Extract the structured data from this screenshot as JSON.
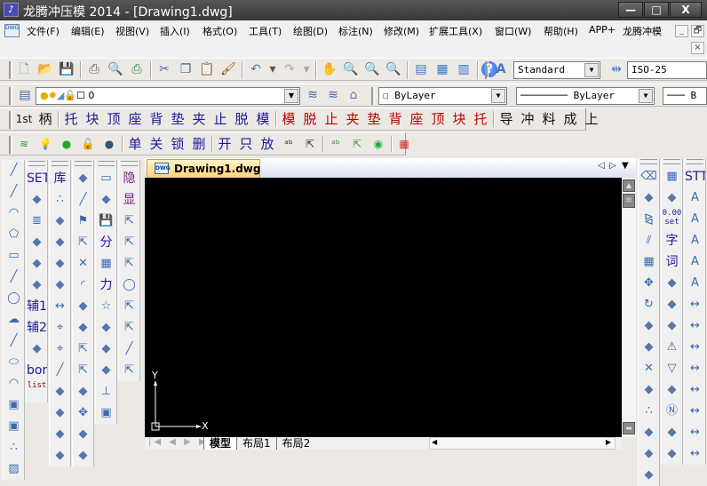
{
  "window": {
    "title": "龙腾冲压模 2014 - [Drawing1.dwg]",
    "minimize": "—",
    "maximize": "□",
    "close": "X"
  },
  "menu": [
    "文件(F)",
    "编辑(E)",
    "视图(V)",
    "插入(I)",
    "格式(O)",
    "工具(T)",
    "绘图(D)",
    "标注(N)",
    "修改(M)",
    "扩展工具(X)",
    "窗口(W)",
    "帮助(H)",
    "APP+",
    "龙腾冲模"
  ],
  "mdi": {
    "minimize": "_",
    "restore": "🗗",
    "close": "×"
  },
  "standard_toolbar": [
    "new-icon",
    "open-icon",
    "save-icon",
    "|",
    "print-icon",
    "print-preview-icon",
    "publish-icon",
    "|",
    "cut-icon",
    "copy-icon",
    "paste-icon",
    "match-properties-icon",
    "|",
    "undo-icon",
    "undo-dropdown-icon",
    "redo-icon",
    "redo-dropdown-icon",
    "|",
    "pan-icon",
    "zoom-realtime-icon",
    "zoom-window-icon",
    "zoom-previous-icon",
    "|",
    "properties-icon",
    "design-center-icon",
    "tool-palettes-icon",
    "|",
    "help-icon"
  ],
  "text_style": {
    "value": "Standard"
  },
  "dim_style": {
    "value": "ISO-25"
  },
  "layer": {
    "value": "0"
  },
  "color": {
    "value": "ByLayer"
  },
  "linetype": {
    "value": "ByLayer"
  },
  "lineweight": {
    "value": "B"
  },
  "row3": {
    "blue": [
      "1st",
      "柄",
      "托",
      "块",
      "顶",
      "座",
      "背",
      "垫",
      "夹",
      "止",
      "脱",
      "模"
    ],
    "red": [
      "模",
      "脱",
      "止",
      "夹",
      "垫",
      "背",
      "座",
      "顶",
      "块",
      "托"
    ],
    "black": [
      "导",
      "冲",
      "料",
      "成",
      "上"
    ]
  },
  "row4": {
    "texts": [
      "单",
      "关",
      "锁",
      "删",
      "开",
      "只",
      "放"
    ]
  },
  "left_cols": [
    [
      "line-icon",
      "polyline-icon",
      "arc-icon",
      "polygon-icon",
      "rectangle-icon",
      "spline-flyout-icon",
      "circle-icon",
      "revcloud-icon",
      "spline-icon",
      "ellipse-icon",
      "ellipse-arc-icon",
      "insert-block-icon",
      "make-block-icon",
      "point-icon",
      "hatch-icon"
    ],
    [
      {
        "t": "SET"
      },
      "frame-icon",
      "spring-icon",
      "plate-icon",
      "die-set-icon",
      "pin-icon",
      {
        "t": "辅1"
      },
      {
        "t": "辅2"
      },
      "material-icon",
      {
        "t": "bom"
      },
      {
        "t": "list"
      }
    ],
    [
      {
        "t": "库"
      },
      "square-point-icon",
      "slot-icon",
      "cavity-icon",
      "punch-icon",
      "plate-view-icon",
      "dimension-box-icon",
      "center-mark-icon",
      "target-icon",
      "hatch-lines-icon",
      "bend-icon",
      "zigzag-icon",
      "profile-icon",
      "pin-small-icon"
    ],
    [
      "broom-icon",
      "offset-lines-icon",
      "flag-icon",
      "flag-select-icon",
      "trim-icon",
      "fillet-icon",
      "edit-curve-icon",
      "break-icon",
      "gear-select-icon",
      "rotate-select-icon",
      "scale-icon",
      "move-diamond-icon",
      "stretch-icon",
      "sparkle-icon"
    ],
    [
      "window-icon",
      "cluster-icon",
      "disk-icon",
      {
        "t": "分"
      },
      "calculator-icon",
      {
        "t": "力"
      },
      "star-icon",
      "press-icon",
      "holes-icon",
      "stack-icon",
      "bolt-icon",
      "punch-block-icon"
    ],
    [
      {
        "t": "隐"
      },
      {
        "t": "显"
      },
      "ab-select-icon",
      "dim-select-icon",
      "snap-select-icon",
      "circle-select-icon",
      "blue-select-icon",
      "color-select-icon",
      "lines-select-icon",
      "purple-select-icon"
    ]
  ],
  "drawing_tab": {
    "label": "Drawing1.dwg"
  },
  "layout_tabs": [
    "模型",
    "布局1",
    "布局2"
  ],
  "ucs": {
    "x": "X",
    "y": "Y"
  },
  "right_cols": [
    [
      "erase-icon",
      "copy-obj-icon",
      "mirror-icon",
      "offset-icon",
      "array-icon",
      "move-icon",
      "rotate-icon",
      "scale-obj-icon",
      "stretch-obj-icon",
      "trim-obj-icon",
      "extend-icon",
      "break-point-icon",
      "break-obj-icon",
      "join-icon",
      "chamfer-icon"
    ],
    [
      "table-icon",
      "coordinates-icon",
      {
        "t": "0.00 set"
      },
      {
        "t": "字"
      },
      {
        "t": "词"
      },
      "annotation-icon",
      "annotation2-icon",
      "leader-icon",
      "datum-icon",
      "roughness-icon",
      "balloon-icon",
      "north-icon",
      "symbol1-icon",
      "symbol2-icon"
    ],
    [
      {
        "t": "STT"
      },
      "edit-text-icon",
      "text-height-icon",
      "text-replace-icon",
      "text-paint-icon",
      "text-add-icon",
      "dim-edit-icon",
      "eh-dim-icon",
      "le-dim-icon",
      "decimal-dim-icon",
      "angle-dim-icon",
      "zero-dim-icon",
      "ratio-dim-icon",
      "fifteen-dim-icon"
    ]
  ],
  "colors": {
    "blue_text": "#1a1aa0",
    "red_text": "#c00000",
    "canvas": "#000000"
  }
}
